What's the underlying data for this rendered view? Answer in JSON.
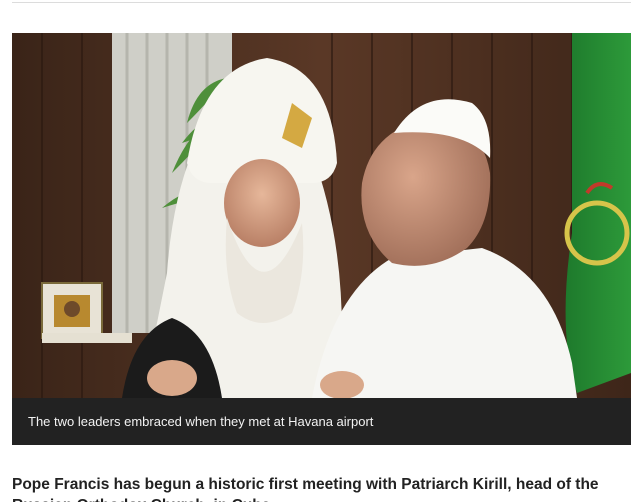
{
  "figure": {
    "image_description_icon": "photo-two-religious-leaders-embracing",
    "caption": "The two leaders embraced when they met at Havana airport"
  },
  "article": {
    "intro": "Pope Francis has begun a historic first meeting with Patriarch Kirill, head of the Russian Orthodox Church, in Cuba."
  },
  "colors": {
    "caption_bg": "#222222",
    "caption_text": "#f2f2f2",
    "body_text": "#222222"
  }
}
